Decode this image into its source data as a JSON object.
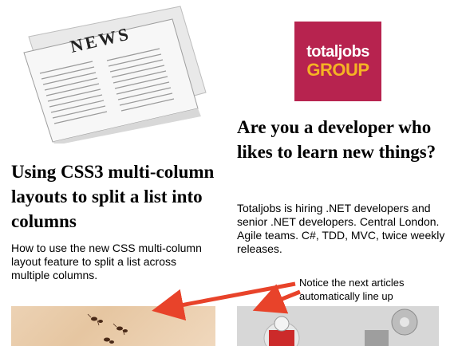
{
  "left_article": {
    "image_icon": "newspaper-illustration",
    "image_text": "NEWS",
    "title": "Using CSS3 multi-column layouts to split a list into columns",
    "summary": "How to use the new CSS multi-column layout feature to split a list across multiple columns."
  },
  "right_article": {
    "logo_top": "totaljobs",
    "logo_bottom": "GROUP",
    "logo_color": "#b7234f",
    "title": "Are you a developer who likes to learn new things?",
    "summary": "Totaljobs is hiring .NET developers and senior .NET developers. Central London. Agile teams. C#, TDD, MVC, twice weekly releases."
  },
  "annotation": {
    "text": "Notice the next articles automatically line up",
    "arrow_color": "#e8432a"
  },
  "next_articles": {
    "left_thumb_icon": "ants-photo",
    "right_thumb_icon": "lego-figure-photo"
  }
}
